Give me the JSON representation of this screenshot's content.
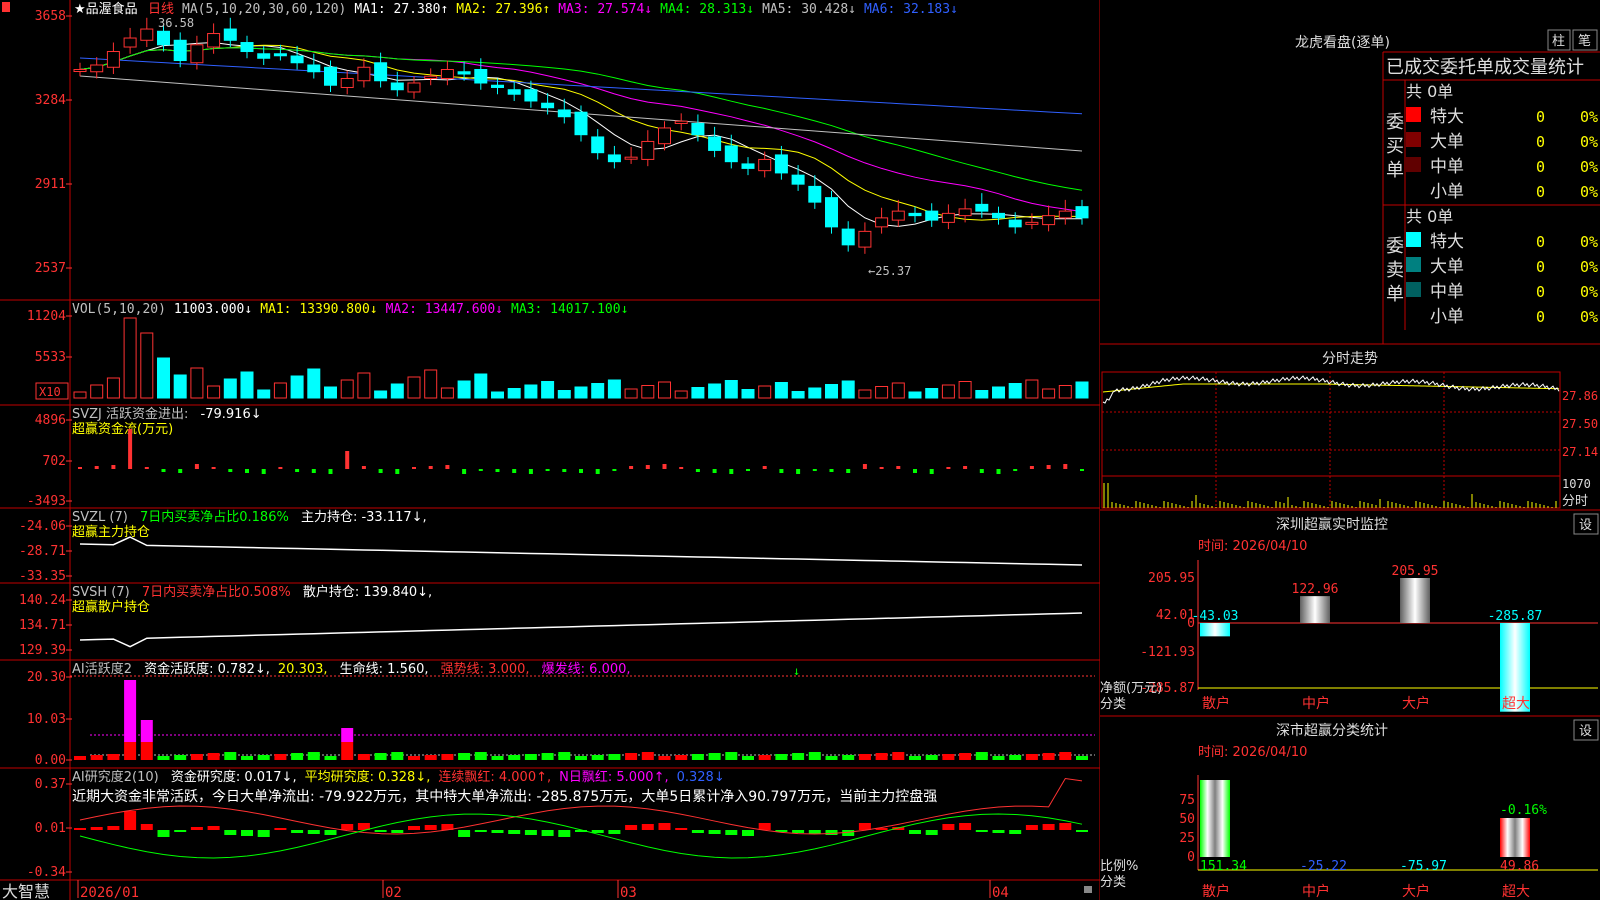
{
  "colors": {
    "red": "#ff3232",
    "cyan": "#00ffff",
    "white": "#ffffff",
    "yellow": "#ffff00",
    "magenta": "#ff00ff",
    "green": "#00ff00",
    "blue": "#3060ff",
    "grey": "#c0c0c0",
    "darkred": "#800000",
    "teal": "#008080",
    "border": "#c00000"
  },
  "main": {
    "stock_name": "★品渥食品",
    "period": "日线",
    "header_items": [
      {
        "text": "MA(5,10,20,30,60,120)",
        "color": "#c0c0c0"
      },
      {
        "text": "MA1: 27.380↑",
        "color": "#ffffff"
      },
      {
        "text": "MA2: 27.396↑",
        "color": "#ffff00"
      },
      {
        "text": "MA3: 27.574↓",
        "color": "#ff00ff"
      },
      {
        "text": "MA4: 28.313↓",
        "color": "#00ff00"
      },
      {
        "text": "MA5: 30.428↓",
        "color": "#c0c0c0"
      },
      {
        "text": "MA6: 32.183↓",
        "color": "#3060ff"
      }
    ],
    "price_axis": [
      "3658",
      "3284",
      "2911",
      "2537"
    ],
    "high_label": "36.58",
    "low_label": "←25.37"
  },
  "vol": {
    "header": [
      {
        "text": "VOL(5,10,20)",
        "color": "#c0c0c0"
      },
      {
        "text": "11003.000↓",
        "color": "#ffffff"
      },
      {
        "text": "MA1: 13390.800↓",
        "color": "#ffff00"
      },
      {
        "text": "MA2: 13447.600↓",
        "color": "#ff00ff"
      },
      {
        "text": "MA3: 14017.100↓",
        "color": "#00ff00"
      }
    ],
    "axis": [
      "11204",
      "5533"
    ],
    "unit": "X10"
  },
  "svzj": {
    "header": [
      {
        "text": "SVZJ  活跃资金进出: ",
        "color": "#c0c0c0"
      },
      {
        "text": "-79.916↓",
        "color": "#ffffff"
      }
    ],
    "subtitle": "超赢资金流(万元)",
    "axis": [
      "4896",
      "702",
      "-3493"
    ]
  },
  "svzl": {
    "header": [
      {
        "text": "SVZL (7) ",
        "color": "#c0c0c0"
      },
      {
        "text": "7日内买卖净占比0.186%",
        "color": "#00ff00"
      },
      {
        "text": " 主力持仓: -33.117↓,",
        "color": "#ffffff"
      }
    ],
    "subtitle": "超赢主力持仓",
    "axis": [
      "-24.06",
      "-28.71",
      "-33.35"
    ]
  },
  "svsh": {
    "header": [
      {
        "text": "SVSH (7) ",
        "color": "#c0c0c0"
      },
      {
        "text": "7日内买卖净占比0.508%",
        "color": "#ff3232"
      },
      {
        "text": " 散户持仓: 139.840↓,",
        "color": "#ffffff"
      }
    ],
    "subtitle": "超赢散户持仓",
    "axis": [
      "140.24",
      "134.71",
      "129.39"
    ]
  },
  "ai1": {
    "header": [
      {
        "text": "AI活跃度2 ",
        "color": "#c0c0c0"
      },
      {
        "text": "资金活跃度: 0.782↓,",
        "color": "#ffffff"
      },
      {
        "text": "20.303,",
        "color": "#ffff00"
      },
      {
        "text": " 生命线: 1.560,",
        "color": "#ffffff"
      },
      {
        "text": " 强势线: 3.000,",
        "color": "#ff3232"
      },
      {
        "text": " 爆发线: 6.000,",
        "color": "#ff00ff"
      }
    ],
    "axis": [
      "20.30",
      "10.03",
      "0.00"
    ]
  },
  "ai2": {
    "header": [
      {
        "text": "AI研究度2(10) ",
        "color": "#c0c0c0"
      },
      {
        "text": "资金研究度: 0.017↓,",
        "color": "#ffffff"
      },
      {
        "text": "平均研究度: 0.328↓,",
        "color": "#ffff00"
      },
      {
        "text": "连续飘红: 4.000↑,",
        "color": "#ff3232"
      },
      {
        "text": "N日飘红: 5.000↑,",
        "color": "#ff00ff"
      },
      {
        "text": "0.328↓",
        "color": "#3060ff"
      }
    ],
    "commentary": "近期大资金非常活跃，今日大单净流出: -79.922万元，其中特大单净流出: -285.875万元，大单5日累计净入90.797万元，当前主力控盘强",
    "axis": [
      "0.37",
      "0.01",
      "-0.34"
    ]
  },
  "bottom": {
    "brand": "大智慧",
    "dates": [
      "2026/01",
      "02",
      "03",
      "04"
    ]
  },
  "right": {
    "dragon": {
      "title": "龙虎看盘(逐单)",
      "btn_zhu": "柱",
      "btn_bi": "笔",
      "subtitle": "已成交委托单成交量统计",
      "buy_label": "委买单",
      "sell_label": "委卖单",
      "buy_total": "共 0单",
      "sell_total": "共 0单",
      "buy_rows": [
        {
          "name": "特大",
          "value": "0",
          "pct": "0%"
        },
        {
          "name": "大单",
          "value": "0",
          "pct": "0%"
        },
        {
          "name": "中单",
          "value": "0",
          "pct": "0%"
        },
        {
          "name": "小单",
          "value": "0",
          "pct": "0%"
        }
      ],
      "sell_rows": [
        {
          "name": "特大",
          "value": "0",
          "pct": "0%"
        },
        {
          "name": "大单",
          "value": "0",
          "pct": "0%"
        },
        {
          "name": "中单",
          "value": "0",
          "pct": "0%"
        },
        {
          "name": "小单",
          "value": "0",
          "pct": "0%"
        }
      ]
    },
    "intraday": {
      "title": "分时走势",
      "axis": [
        "27.86",
        "27.50",
        "27.14"
      ],
      "vol_label": "1070",
      "vol_caption": "分时"
    },
    "monitor": {
      "title": "深圳超赢实时监控",
      "btn": "设",
      "time": "时间: 2026/04/10",
      "axis": [
        "205.95",
        "42.01",
        "0",
        "-121.93",
        "-285.87"
      ],
      "ylabel1": "净额(万元)",
      "ylabel2": "分类",
      "bars": [
        {
          "cat": "散户",
          "value": -43.03
        },
        {
          "cat": "中户",
          "value": 122.96
        },
        {
          "cat": "大户",
          "value": 205.95
        },
        {
          "cat": "超大",
          "value": -285.87
        }
      ]
    },
    "classify": {
      "title": "深市超赢分类统计",
      "btn": "设",
      "time": "时间: 2026/04/10",
      "axis": [
        "75",
        "50",
        "25",
        "0"
      ],
      "ylabel1": "比例%",
      "ylabel2": "分类",
      "bars": [
        {
          "cat": "散户",
          "value": "151.34"
        },
        {
          "cat": "中户",
          "value": "-25.22"
        },
        {
          "cat": "大户",
          "value": "-75.97"
        },
        {
          "cat": "超大",
          "value": "49.86"
        }
      ],
      "top_label": "-0.16%"
    }
  }
}
